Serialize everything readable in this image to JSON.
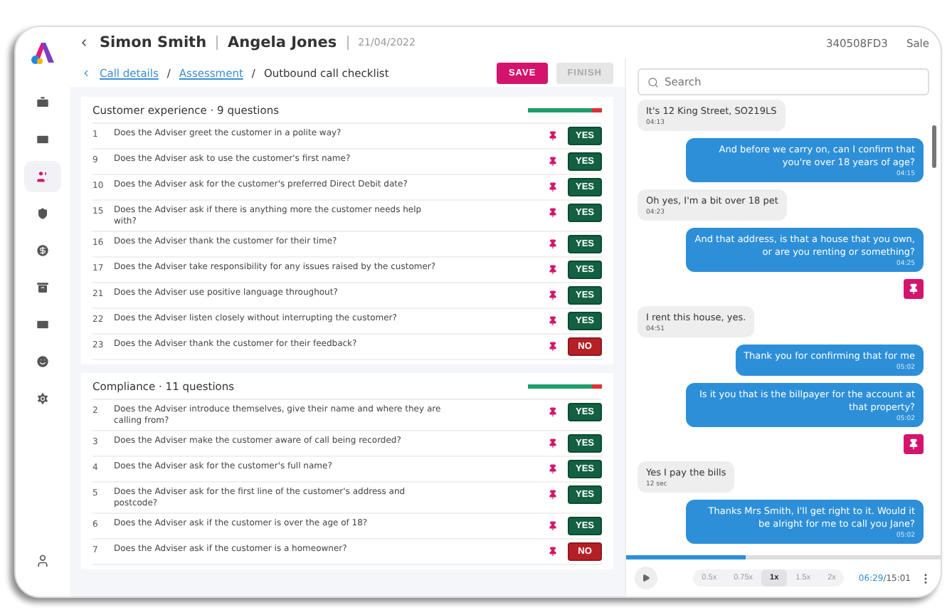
{
  "sidebar": {
    "items": [
      {
        "kind": "briefcase",
        "selected": false
      },
      {
        "kind": "card",
        "selected": false
      },
      {
        "kind": "people",
        "selected": true
      },
      {
        "kind": "shield",
        "selected": false
      },
      {
        "kind": "dollar",
        "selected": false
      },
      {
        "kind": "archive",
        "selected": false
      },
      {
        "kind": "card",
        "selected": false
      },
      {
        "kind": "face",
        "selected": false
      },
      {
        "kind": "settings",
        "selected": false
      }
    ],
    "footer": {
      "kind": "user"
    }
  },
  "header": {
    "adviser": "Simon Smith",
    "customer": "Angela Jones",
    "date": "21/04/2022",
    "reference": "340508FD3",
    "call_type": "Sale"
  },
  "breadcrumb": {
    "links": [
      {
        "label": "Call details",
        "separator": "/"
      },
      {
        "label": "Assessment",
        "separator": "/"
      }
    ],
    "current": "Outbound call checklist"
  },
  "actions": [
    {
      "label": "SAVE",
      "disabled": false
    },
    {
      "label": "FINISH",
      "disabled": true
    }
  ],
  "sections": [
    {
      "title": "Customer experience · 9 questions",
      "level": 0.86,
      "questions": [
        {
          "number": "1",
          "text": "Does the Adviser greet the customer in a polite way?",
          "answer": "YES",
          "positive": true
        },
        {
          "number": "9",
          "text": "Does the Adviser ask to use the customer's first name?",
          "answer": "YES",
          "positive": true
        },
        {
          "number": "10",
          "text": "Does the Adviser ask for the customer's preferred Direct Debit date?",
          "answer": "YES",
          "positive": true
        },
        {
          "number": "15",
          "text": "Does the Adviser ask if there is anything more the customer needs help with?",
          "answer": "YES",
          "positive": true
        },
        {
          "number": "16",
          "text": "Does the Adviser thank the customer for their time?",
          "answer": "YES",
          "positive": true
        },
        {
          "number": "17",
          "text": "Does the Adviser take responsibility for any issues raised by the customer?",
          "answer": "YES",
          "positive": true
        },
        {
          "number": "21",
          "text": "Does the Adviser use positive language throughout?",
          "answer": "YES",
          "positive": true
        },
        {
          "number": "22",
          "text": "Does the Adviser listen closely without interrupting the customer?",
          "answer": "YES",
          "positive": true
        },
        {
          "number": "23",
          "text": "Does the Adviser thank the customer for their feedback?",
          "answer": "NO",
          "positive": false
        }
      ]
    },
    {
      "title": "Compliance · 11 questions",
      "level": 0.86,
      "questions": [
        {
          "number": "2",
          "text": "Does the Adviser introduce themselves, give their name and where they are calling from?",
          "answer": "YES",
          "positive": true
        },
        {
          "number": "3",
          "text": "Does the Adviser make the customer aware of call being recorded?",
          "answer": "YES",
          "positive": true
        },
        {
          "number": "4",
          "text": "Does the Adviser ask for the customer's full name?",
          "answer": "YES",
          "positive": true
        },
        {
          "number": "5",
          "text": "Does the Adviser ask for the first line of the customer's address and postcode?",
          "answer": "YES",
          "positive": true
        },
        {
          "number": "6",
          "text": "Does the Adviser ask if the customer is over the age of 18?",
          "answer": "YES",
          "positive": true
        },
        {
          "number": "7",
          "text": "Does the Adviser ask if the customer is a homeowner?",
          "answer": "NO",
          "positive": false
        }
      ]
    }
  ],
  "transcript": {
    "search": {
      "placeholder": "Search"
    },
    "messages": [
      {
        "kind": "customer",
        "text": "It's 12 King Street, SO219LS",
        "time": "04:13",
        "pinned": false
      },
      {
        "kind": "adviser",
        "text": "And before we carry on, can I confirm that you're over 18 years of age?",
        "time": "04:15",
        "pinned": false
      },
      {
        "kind": "customer",
        "text": "Oh yes, I'm a bit over 18 pet",
        "time": "04:23",
        "pinned": false
      },
      {
        "kind": "adviser",
        "text": "And that address, is that a house that you own, or are you renting or something?",
        "time": "04:25",
        "pinned": true
      },
      {
        "kind": "customer",
        "text": "I rent this house, yes.",
        "time": "04:51",
        "pinned": false
      },
      {
        "kind": "adviser",
        "text": "Thank you for confirming that for me",
        "time": "05:02",
        "pinned": false
      },
      {
        "kind": "adviser",
        "text": "Is it you that is the billpayer for the account at that property?",
        "time": "05:02",
        "pinned": true
      },
      {
        "kind": "customer",
        "text": "Yes I pay the bills",
        "time": "12 sec",
        "pinned": false
      },
      {
        "kind": "adviser",
        "text": "Thanks Mrs Smith, I'll get right to it. Would it be alright for me to call you Jane?",
        "time": "05:02",
        "pinned": false
      }
    ]
  },
  "player": {
    "level": 0.38,
    "speeds": [
      {
        "label": "0.5x",
        "selected": false
      },
      {
        "label": "0.75x",
        "selected": false
      },
      {
        "label": "1x",
        "selected": true
      },
      {
        "label": "1.5x",
        "selected": false
      },
      {
        "label": "2x",
        "selected": false
      }
    ],
    "elapsed": "06:29",
    "total": "/15:01"
  }
}
